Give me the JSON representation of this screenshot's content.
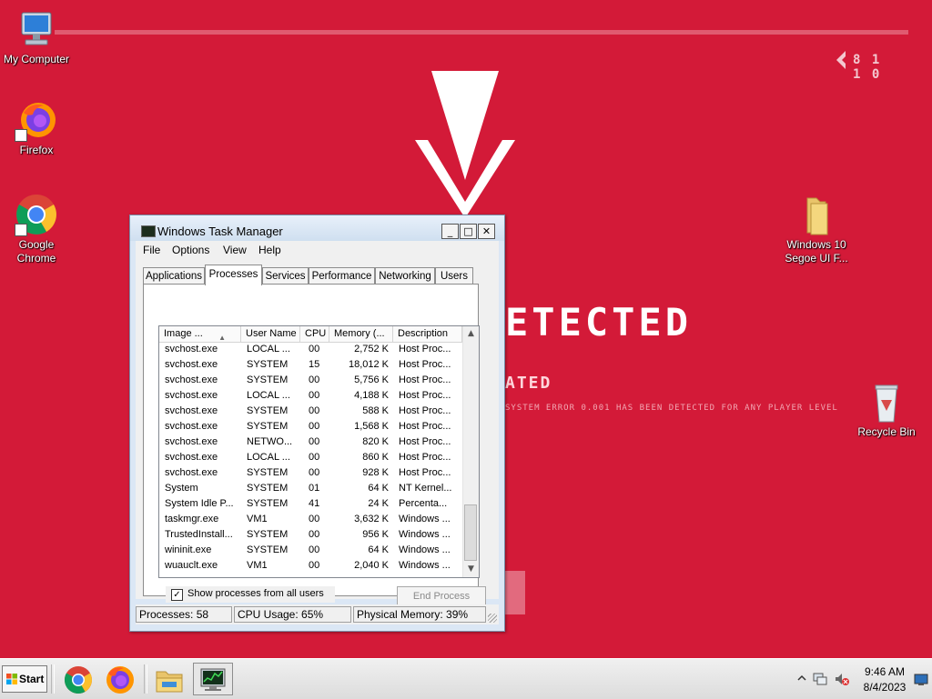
{
  "desktop": {
    "icons": [
      {
        "label": "My Computer"
      },
      {
        "label": "Firefox"
      },
      {
        "label": "Google Chrome"
      },
      {
        "label": "Windows 10 Segoe UI F..."
      },
      {
        "label": "Recycle Bin"
      }
    ],
    "wallpaper": {
      "logo_text": "8 1 1 0",
      "headline": "ETECTED",
      "subline": "ATED",
      "fine_print": "SYSTEM ERROR 0.001 HAS BEEN DETECTED FOR ANY PLAYER LEVEL"
    },
    "colors": {
      "background": "#d31a38",
      "accent": "#ffffff"
    }
  },
  "task_manager": {
    "title": "Windows Task Manager",
    "window_controls": {
      "minimize": "_",
      "maximize": "□",
      "close": "✕"
    },
    "menu": [
      "File",
      "Options",
      "View",
      "Help"
    ],
    "tabs": [
      {
        "label": "Applications"
      },
      {
        "label": "Processes"
      },
      {
        "label": "Services"
      },
      {
        "label": "Performance"
      },
      {
        "label": "Networking"
      },
      {
        "label": "Users"
      }
    ],
    "active_tab": "Processes",
    "columns": [
      "Image ...",
      "User Name",
      "CPU",
      "Memory (...",
      "Description"
    ],
    "sort_indicator": "▲",
    "processes": [
      {
        "image": "svchost.exe",
        "user": "LOCAL ...",
        "cpu": "00",
        "memory": "2,752 K",
        "description": "Host Proc..."
      },
      {
        "image": "svchost.exe",
        "user": "SYSTEM",
        "cpu": "15",
        "memory": "18,012 K",
        "description": "Host Proc..."
      },
      {
        "image": "svchost.exe",
        "user": "SYSTEM",
        "cpu": "00",
        "memory": "5,756 K",
        "description": "Host Proc..."
      },
      {
        "image": "svchost.exe",
        "user": "LOCAL ...",
        "cpu": "00",
        "memory": "4,188 K",
        "description": "Host Proc..."
      },
      {
        "image": "svchost.exe",
        "user": "SYSTEM",
        "cpu": "00",
        "memory": "588 K",
        "description": "Host Proc..."
      },
      {
        "image": "svchost.exe",
        "user": "SYSTEM",
        "cpu": "00",
        "memory": "1,568 K",
        "description": "Host Proc..."
      },
      {
        "image": "svchost.exe",
        "user": "NETWO...",
        "cpu": "00",
        "memory": "820 K",
        "description": "Host Proc..."
      },
      {
        "image": "svchost.exe",
        "user": "LOCAL ...",
        "cpu": "00",
        "memory": "860 K",
        "description": "Host Proc..."
      },
      {
        "image": "svchost.exe",
        "user": "SYSTEM",
        "cpu": "00",
        "memory": "928 K",
        "description": "Host Proc..."
      },
      {
        "image": "System",
        "user": "SYSTEM",
        "cpu": "01",
        "memory": "64 K",
        "description": "NT Kernel..."
      },
      {
        "image": "System Idle P...",
        "user": "SYSTEM",
        "cpu": "41",
        "memory": "24 K",
        "description": "Percenta..."
      },
      {
        "image": "taskmgr.exe",
        "user": "VM1",
        "cpu": "00",
        "memory": "3,632 K",
        "description": "Windows ..."
      },
      {
        "image": "TrustedInstall...",
        "user": "SYSTEM",
        "cpu": "00",
        "memory": "956 K",
        "description": "Windows ..."
      },
      {
        "image": "wininit.exe",
        "user": "SYSTEM",
        "cpu": "00",
        "memory": "64 K",
        "description": "Windows ..."
      },
      {
        "image": "wuauclt.exe",
        "user": "VM1",
        "cpu": "00",
        "memory": "2,040 K",
        "description": "Windows ..."
      }
    ],
    "scroll": {
      "up": "▲",
      "down": "▼"
    },
    "show_all_users": {
      "checked": true,
      "check_glyph": "✓",
      "label": "Show processes from all users"
    },
    "end_process_label": "End Process",
    "status": {
      "processes": "Processes: 58",
      "cpu": "CPU Usage: 65%",
      "memory": "Physical Memory: 39%"
    }
  },
  "taskbar": {
    "start_label": "Start",
    "pinned": [
      "chrome-icon",
      "firefox-icon",
      "explorer-icon",
      "taskmgr-icon"
    ],
    "tray": {
      "expand_glyph": "^",
      "time": "9:46 AM",
      "date": "8/4/2023"
    }
  }
}
